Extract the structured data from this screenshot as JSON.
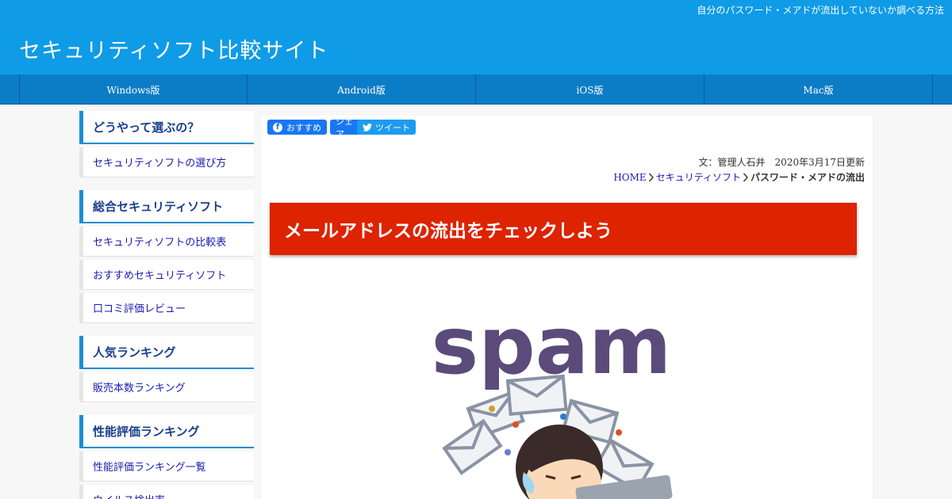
{
  "header": {
    "tagline": "自分のパスワード・メアドが流出していないか調べる方法",
    "site_title": "セキュリティソフト比較サイト"
  },
  "nav": {
    "items": [
      "Windows版",
      "Android版",
      "iOS版",
      "Mac版"
    ]
  },
  "sidebar": {
    "sections": [
      {
        "heading": "どうやって選ぶの？",
        "items": [
          "セキュリティソフトの選び方"
        ]
      },
      {
        "heading": "総合セキュリティソフト",
        "items": [
          "セキュリティソフトの比較表",
          "おすすめセキュリティソフト",
          "口コミ評価レビュー"
        ]
      },
      {
        "heading": "人気ランキング",
        "items": [
          "販売本数ランキング"
        ]
      },
      {
        "heading": "性能評価ランキング",
        "items": [
          "性能評価ランキング一覧",
          "ウイルス検出率"
        ]
      }
    ]
  },
  "share": {
    "facebook_label": "おすすめ",
    "share_label": "シェア",
    "twitter_label": "ツイート"
  },
  "article": {
    "meta": "文：管理人石井　2020年3月17日更新",
    "breadcrumb": [
      "HOME",
      "セキュリティソフト",
      "パスワード・メアドの流出"
    ],
    "title": "メールアドレスの流出をチェックしよう",
    "illustration_text": "spam"
  },
  "colors": {
    "header": "#0f9be6",
    "nav": "#0b7cc6",
    "title_banner": "#dd2300",
    "sidebar_accent": "#1e8ed3",
    "link": "#1a1ab0"
  }
}
